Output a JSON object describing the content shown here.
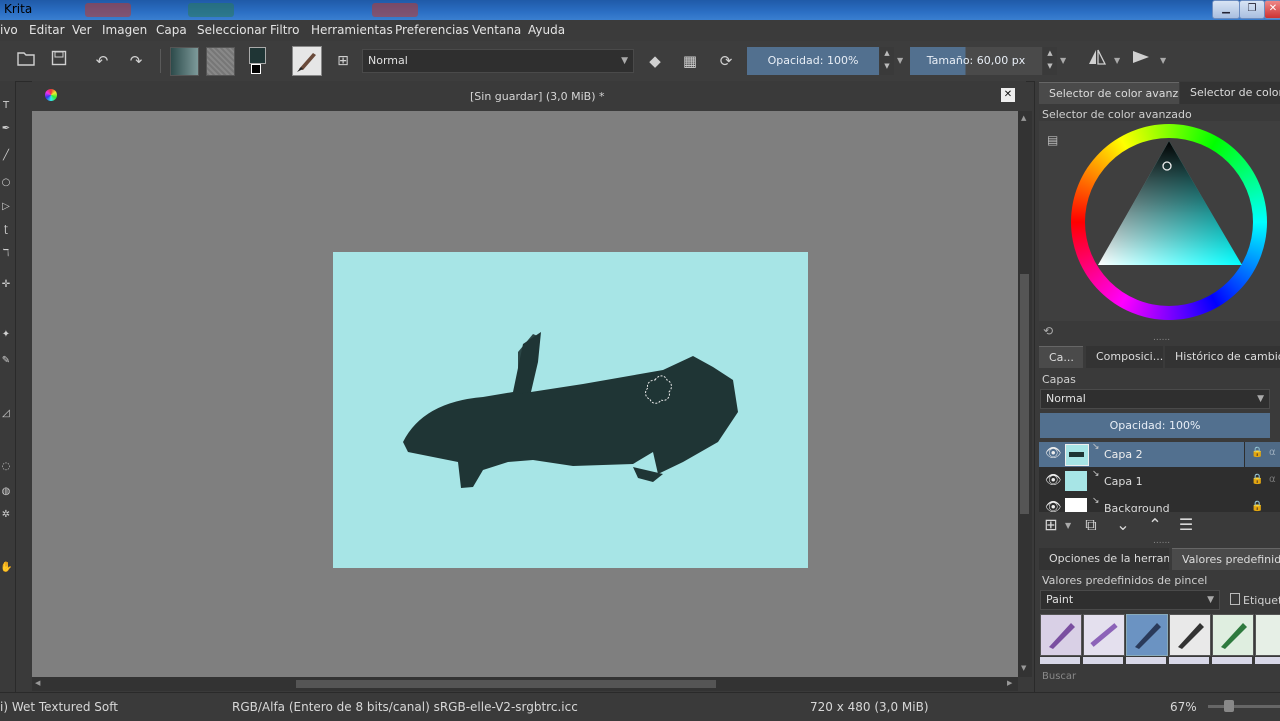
{
  "window": {
    "title": "Krita"
  },
  "menubar": [
    "ivo",
    "Editar",
    "Ver",
    "Imagen",
    "Capa",
    "Seleccionar",
    "Filtro",
    "Herramientas",
    "Preferencias",
    "Ventana",
    "Ayuda"
  ],
  "toolbar": {
    "blend_mode": "Normal",
    "opacity_label": "Opacidad:",
    "opacity_value": "100%",
    "size_label": "Tamaño:",
    "size_value": "60,00 px"
  },
  "document": {
    "tab_title": "[Sin guardar]  (3,0 MiB) *"
  },
  "canvas": {
    "background_color": "#a7e5e6",
    "stroke_color": "#1f3535"
  },
  "docker": {
    "color_tabs": [
      "Selector de color avanz...",
      "Selector de color esp"
    ],
    "color_panel_title": "Selector de color avanzado",
    "layer_tabs": [
      "Ca...",
      "Composici...",
      "Histórico de cambios de"
    ],
    "layers_title": "Capas",
    "layers_blend_mode": "Normal",
    "layers_opacity": "Opacidad:  100%",
    "layers": [
      {
        "name": "Capa 2",
        "selected": true
      },
      {
        "name": "Capa 1",
        "selected": false
      },
      {
        "name": "Background",
        "selected": false
      }
    ],
    "bottom_tabs": [
      "Opciones de la herram...",
      "Valores predefinidos d"
    ],
    "presets_title": "Valores predefinidos de pincel",
    "presets_filter": "Paint",
    "tag_label": "Etiqueta",
    "search_placeholder": "Buscar"
  },
  "statusbar": {
    "brush_name": "i) Wet Textured Soft",
    "color_info": "RGB/Alfa (Entero de 8 bits/canal)  sRGB-elle-V2-srgbtrc.icc",
    "dimensions": "720 x 480 (3,0 MiB)",
    "zoom": "67%"
  }
}
